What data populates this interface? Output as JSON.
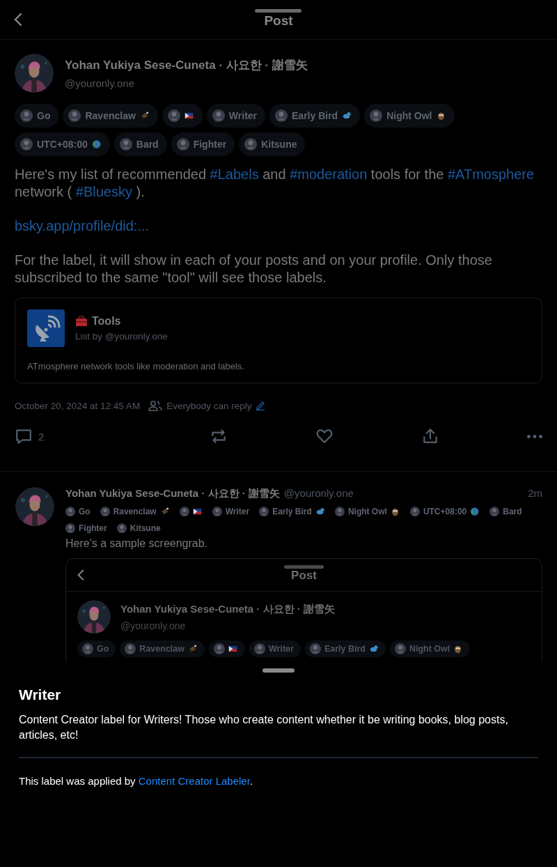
{
  "header": {
    "title": "Post"
  },
  "post": {
    "author": {
      "name": "Yohan Yukiya Sese-Cuneta · 사요한 · 謝雪矢",
      "handle": "@youronly.one"
    },
    "labels": [
      {
        "text": "Go",
        "kind": "plain"
      },
      {
        "text": "Ravenclaw",
        "kind": "eagle"
      },
      {
        "kind": "flag"
      },
      {
        "text": "Writer",
        "kind": "plain"
      },
      {
        "text": "Early Bird",
        "kind": "bird"
      },
      {
        "text": "Night Owl",
        "kind": "owl"
      },
      {
        "text": "UTC+08:00",
        "kind": "globe"
      },
      {
        "text": "Bard",
        "kind": "plain"
      },
      {
        "text": "Fighter",
        "kind": "plain"
      },
      {
        "text": "Kitsune",
        "kind": "plain"
      }
    ],
    "body": [
      [
        {
          "kind": "text",
          "text": "Here's my list of recommended "
        },
        {
          "kind": "link",
          "text": "#Labels"
        },
        {
          "kind": "text",
          "text": " and "
        },
        {
          "kind": "link",
          "text": "#moderation"
        },
        {
          "kind": "text",
          "text": " tools for the "
        },
        {
          "kind": "link",
          "text": "#ATmosphere"
        },
        {
          "kind": "text",
          "text": " network ( "
        },
        {
          "kind": "link",
          "text": "#Bluesky"
        },
        {
          "kind": "text",
          "text": " )."
        }
      ],
      [
        {
          "kind": "link",
          "text": "bsky.app/profile/did:..."
        }
      ],
      [
        {
          "kind": "text",
          "text": "For the label, it will show in each of your posts and on your profile. Only those subscribed to the same \"tool\" will see those labels."
        }
      ]
    ],
    "embed": {
      "title": "Tools",
      "subtitle": "List by @youronly.one",
      "description": "ATmosphere network tools like moderation and labels."
    },
    "timestamp": "October 20, 2024 at 12:45 AM",
    "reply_setting": "Everybody can reply",
    "actions": [
      {
        "kind": "reply",
        "count": "2"
      },
      {
        "kind": "repost"
      },
      {
        "kind": "like"
      },
      {
        "kind": "share"
      },
      {
        "kind": "more"
      }
    ]
  },
  "reply": {
    "author": {
      "name": "Yohan Yukiya Sese-Cuneta · 사요한 · 謝雪矢",
      "handle": "@youronly.one"
    },
    "time": "2m",
    "labels": [
      {
        "text": "Go",
        "kind": "plain"
      },
      {
        "text": "Ravenclaw",
        "kind": "eagle"
      },
      {
        "kind": "flag"
      },
      {
        "text": "Writer",
        "kind": "plain"
      },
      {
        "text": "Early Bird",
        "kind": "bird"
      },
      {
        "text": "Night Owl",
        "kind": "owl"
      },
      {
        "text": "UTC+08:00",
        "kind": "globe"
      },
      {
        "text": "Bard",
        "kind": "plain"
      },
      {
        "text": "Fighter",
        "kind": "plain"
      },
      {
        "text": "Kitsune",
        "kind": "plain"
      }
    ],
    "text": "Here's a sample screengrab.",
    "screenshot": {
      "title": "Post",
      "author": {
        "name": "Yohan Yukiya Sese-Cuneta · 사요한 · 謝雪矢",
        "handle": "@youronly.one"
      },
      "labels": [
        {
          "text": "Go",
          "kind": "plain"
        },
        {
          "text": "Ravenclaw",
          "kind": "eagle"
        },
        {
          "kind": "flag"
        },
        {
          "text": "Writer",
          "kind": "plain"
        },
        {
          "text": "Early Bird",
          "kind": "bird"
        },
        {
          "text": "Night Owl",
          "kind": "owl"
        }
      ]
    }
  },
  "sheet": {
    "title": "Writer",
    "description": "Content Creator label for Writers! Those who create content whether it be writing books, blog posts, articles, etc!",
    "attribution": [
      {
        "kind": "text",
        "text": "This label was applied by "
      },
      {
        "kind": "link",
        "text": "Content Creator Labeler"
      },
      {
        "kind": "text",
        "text": "."
      }
    ]
  }
}
